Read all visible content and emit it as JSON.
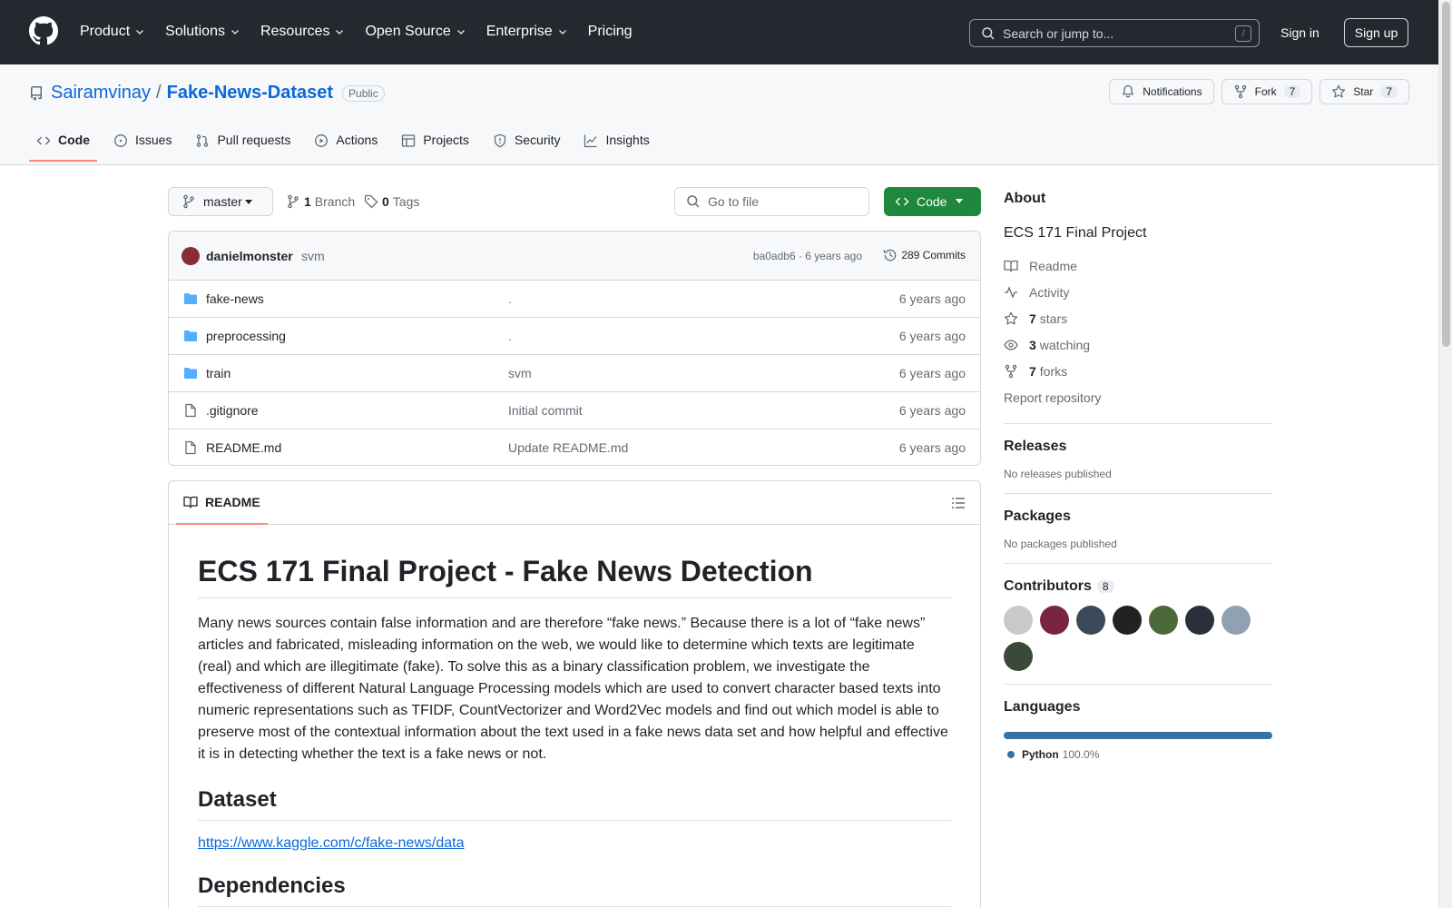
{
  "header": {
    "nav": [
      "Product",
      "Solutions",
      "Resources",
      "Open Source",
      "Enterprise",
      "Pricing"
    ],
    "search_placeholder": "Search or jump to...",
    "search_shortcut": "/",
    "sign_in": "Sign in",
    "sign_up": "Sign up"
  },
  "repo": {
    "owner": "Sairamvinay",
    "separator": "/",
    "name": "Fake-News-Dataset",
    "visibility": "Public",
    "notifications": "Notifications",
    "fork_label": "Fork",
    "fork_count": "7",
    "star_label": "Star",
    "star_count": "7"
  },
  "tabs": [
    "Code",
    "Issues",
    "Pull requests",
    "Actions",
    "Projects",
    "Security",
    "Insights"
  ],
  "browser": {
    "branch": "master",
    "branch_count": "1",
    "branch_label": "Branch",
    "tag_count": "0",
    "tag_label": "Tags",
    "goto_placeholder": "Go to file",
    "code_button": "Code"
  },
  "latest_commit": {
    "author": "danielmonster",
    "message": "svm",
    "meta": "ba0adb6 · 6 years ago",
    "commits": "289 Commits"
  },
  "files": [
    {
      "type": "dir",
      "name": "fake-news",
      "commit": ".",
      "time": "6 years ago"
    },
    {
      "type": "dir",
      "name": "preprocessing",
      "commit": ".",
      "time": "6 years ago"
    },
    {
      "type": "dir",
      "name": "train",
      "commit": "svm",
      "time": "6 years ago"
    },
    {
      "type": "file",
      "name": ".gitignore",
      "commit": "Initial commit",
      "time": "6 years ago"
    },
    {
      "type": "file",
      "name": "README.md",
      "commit": "Update README.md",
      "time": "6 years ago"
    }
  ],
  "readme": {
    "tab": "README",
    "h1": "ECS 171 Final Project - Fake News Detection",
    "intro": "Many news sources contain false information and are therefore “fake news.” Because there is a lot of “fake news” articles and fabricated, misleading information on the web, we would like to determine which texts are legitimate (real) and which are illegitimate (fake). To solve this as a binary classification problem, we investigate the effectiveness of different Natural Language Processing models which are used to convert character based texts into numeric representations such as TFIDF, CountVectorizer and Word2Vec models and find out which model is able to preserve most of the contextual information about the text used in a fake news data set and how helpful and effective it is in detecting whether the text is a fake news or not.",
    "h2_dataset": "Dataset",
    "dataset_link": "https://www.kaggle.com/c/fake-news/data",
    "h2_dependencies": "Dependencies"
  },
  "about": {
    "title": "About",
    "description": "ECS 171 Final Project",
    "readme": "Readme",
    "activity": "Activity",
    "stars_count": "7",
    "stars_label": "stars",
    "watching_count": "3",
    "watching_label": "watching",
    "forks_count": "7",
    "forks_label": "forks",
    "report": "Report repository"
  },
  "releases": {
    "title": "Releases",
    "empty": "No releases published"
  },
  "packages": {
    "title": "Packages",
    "empty": "No packages published"
  },
  "contributors": {
    "title": "Contributors",
    "count": "8",
    "avatar_colors": [
      "#c9c9c9",
      "#7a2540",
      "#3b4a5a",
      "#222222",
      "#4a6a3a",
      "#2a2f3a",
      "#8fa1b3",
      "#3a4a3a"
    ]
  },
  "languages": {
    "title": "Languages",
    "items": [
      {
        "name": "Python",
        "percent": "100.0%",
        "fraction": 1.0,
        "color": "#3572a5"
      }
    ]
  }
}
